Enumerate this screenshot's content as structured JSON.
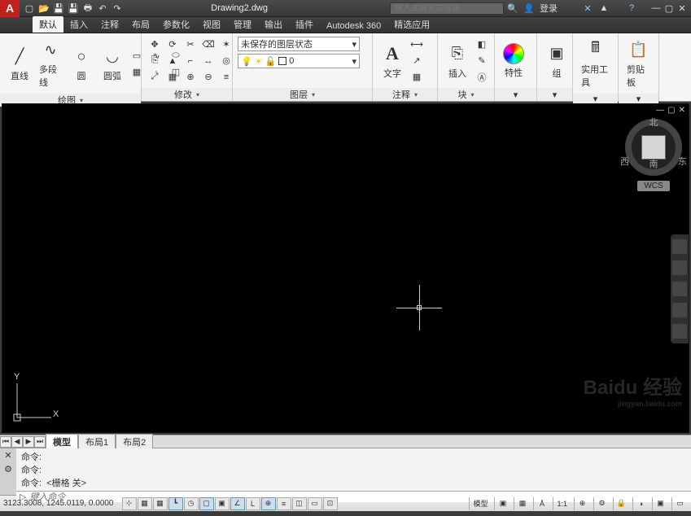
{
  "title": "Drawing2.dwg",
  "search_placeholder": "键入关键字或短语",
  "login_label": "登录",
  "tabs": [
    "默认",
    "插入",
    "注释",
    "布局",
    "参数化",
    "视图",
    "管理",
    "输出",
    "插件",
    "Autodesk 360",
    "精选应用"
  ],
  "active_tab_index": 0,
  "ribbon": {
    "draw": {
      "title": "绘图",
      "btns": [
        "直线",
        "多段线",
        "圆",
        "圆弧"
      ]
    },
    "modify": {
      "title": "修改"
    },
    "layer": {
      "title": "图层",
      "unsaved": "未保存的图层状态",
      "current": "0"
    },
    "annotate": {
      "title": "注释",
      "text_btn": "文字"
    },
    "block": {
      "title": "块",
      "insert_btn": "插入"
    },
    "props": {
      "title": "特性"
    },
    "group": {
      "title": "组"
    },
    "utils": {
      "title": "实用工具"
    },
    "clip": {
      "title": "剪贴板"
    }
  },
  "navcube": {
    "n": "北",
    "s": "南",
    "e": "东",
    "w": "西",
    "wcs": "WCS"
  },
  "layout_tabs": [
    "模型",
    "布局1",
    "布局2"
  ],
  "active_layout_index": 0,
  "cmd": {
    "prompt": "命令:",
    "history_last": "<栅格 关>",
    "placeholder": "键入命令"
  },
  "status": {
    "coords": "3123.3008, 1245.0119, 0.0000",
    "model": "模型",
    "scale": "1:1"
  },
  "watermark": {
    "main": "Baidu 经验",
    "sub": "jingyan.baidu.com"
  },
  "ucs": {
    "x": "X",
    "y": "Y"
  },
  "icons": {
    "line": "╱",
    "pline": "∿",
    "circle": "○",
    "arc": "◡",
    "text_A": "A",
    "insert": "⎘",
    "group": "▣",
    "utils": "🖩",
    "clip": "📋",
    "cmd_icon": "▷"
  }
}
